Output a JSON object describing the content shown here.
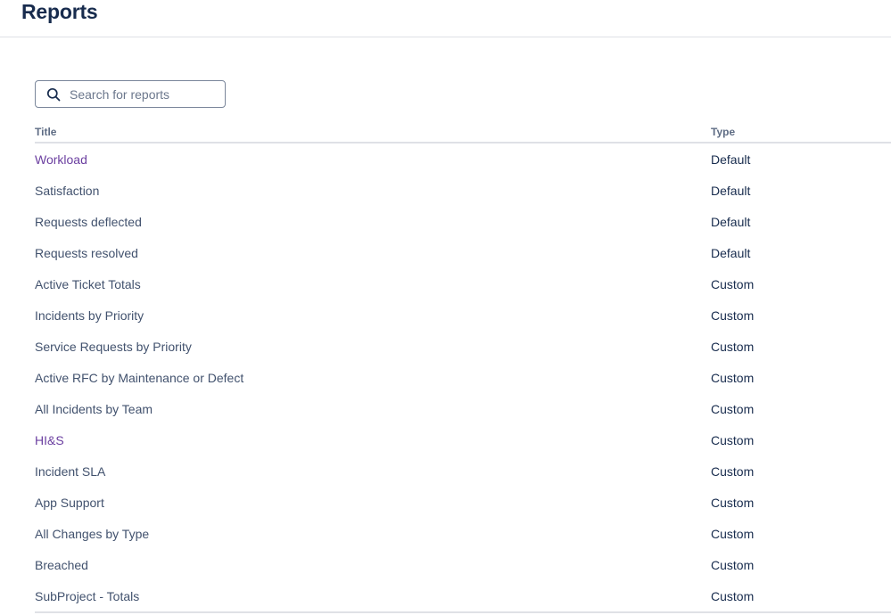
{
  "header": {
    "title": "Reports"
  },
  "search": {
    "placeholder": "Search for reports",
    "value": ""
  },
  "table": {
    "columns": [
      "Title",
      "Type"
    ],
    "rows": [
      {
        "title": "Workload",
        "type": "Default",
        "visited": true
      },
      {
        "title": "Satisfaction",
        "type": "Default",
        "visited": false
      },
      {
        "title": "Requests deflected",
        "type": "Default",
        "visited": false
      },
      {
        "title": "Requests resolved",
        "type": "Default",
        "visited": false
      },
      {
        "title": "Active Ticket Totals",
        "type": "Custom",
        "visited": false
      },
      {
        "title": "Incidents by Priority",
        "type": "Custom",
        "visited": false
      },
      {
        "title": "Service Requests by Priority",
        "type": "Custom",
        "visited": false
      },
      {
        "title": "Active RFC by Maintenance or Defect",
        "type": "Custom",
        "visited": false
      },
      {
        "title": "All Incidents by Team",
        "type": "Custom",
        "visited": false
      },
      {
        "title": "HI&S",
        "type": "Custom",
        "visited": true
      },
      {
        "title": "Incident SLA",
        "type": "Custom",
        "visited": false
      },
      {
        "title": "App Support",
        "type": "Custom",
        "visited": false
      },
      {
        "title": "All Changes by Type",
        "type": "Custom",
        "visited": false
      },
      {
        "title": "Breached",
        "type": "Custom",
        "visited": false
      },
      {
        "title": "SubProject - Totals",
        "type": "Custom",
        "visited": false
      }
    ]
  },
  "colors": {
    "visited_link": "#6b3fa0",
    "text": "#42526e",
    "border": "#dfe1e6"
  },
  "icons": {
    "search": "search-icon"
  }
}
